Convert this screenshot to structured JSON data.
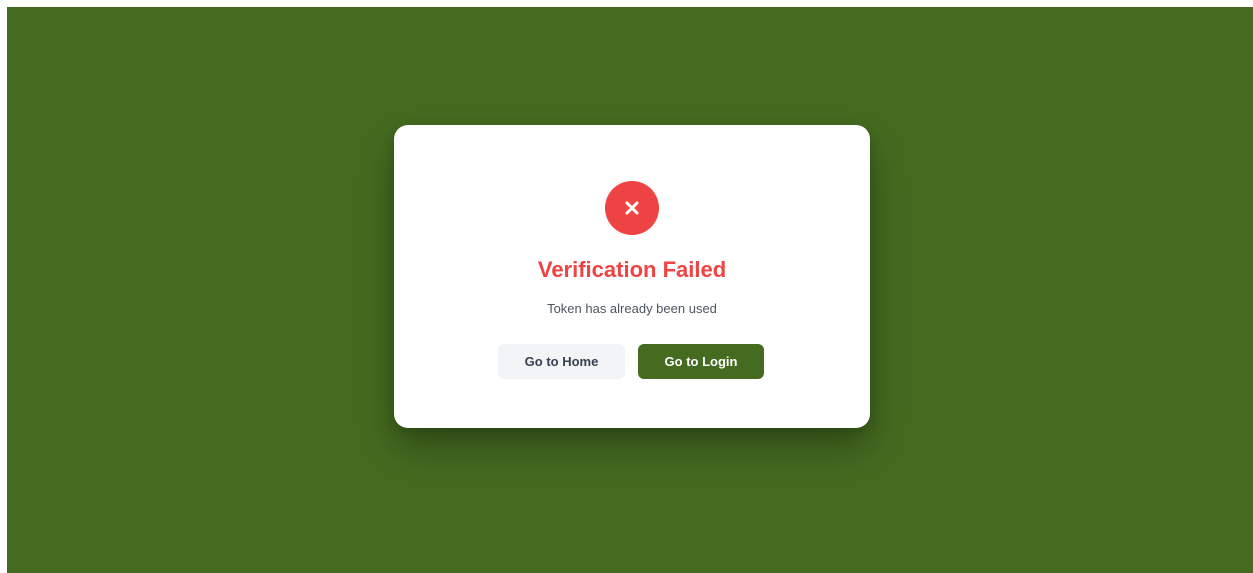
{
  "dialog": {
    "icon": "close-x-icon",
    "title": "Verification Failed",
    "message": "Token has already been used",
    "home_label": "Go to Home",
    "login_label": "Go to Login"
  },
  "colors": {
    "background": "#456b20",
    "error": "#ef4444",
    "primary_button": "#456b20",
    "secondary_button": "#f3f4f6"
  }
}
